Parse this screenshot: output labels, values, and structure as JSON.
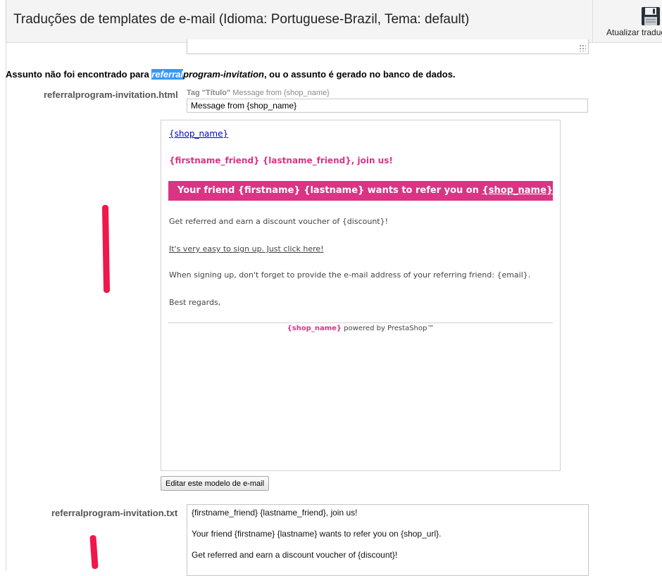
{
  "header": {
    "title": "Traduções de templates de e-mail (Idioma: Portuguese-Brazil, Tema: default)",
    "save_button_label": "Atualizar traduções",
    "save_icon": "floppy-disk-icon"
  },
  "subject_warning": {
    "prefix": "Assunto não foi encontrado para ",
    "highlight": "referral",
    "template_rest": "program-invitation",
    "suffix": ", ou o assunto é gerado no banco de dados."
  },
  "html_template": {
    "label": "referralprogram-invitation.html",
    "tag_label": "Tag \"Título\"",
    "tag_value": " Message from {shop_name}",
    "subject_value": "Message from {shop_name}",
    "edit_button": "Editar este modelo de e-mail",
    "preview": {
      "shop_link": "{shop_name}",
      "join_line": "{firstname_friend} {lastname_friend}, join us!",
      "banner_text": "Your friend {firstname} {lastname} wants to refer you on ",
      "banner_link": "{shop_name}",
      "banner_end": "!",
      "p1": "Get referred and earn a discount voucher of {discount}!",
      "p2": "It's very easy to sign up. Just click here!",
      "p3": "When signing up, don't forget to provide the e-mail address of your referring friend: {email}.",
      "p4": "Best regards,",
      "footer_shop": "{shop_name}",
      "footer_rest": " powered by PrestaShop™"
    },
    "accent_color": "#db3484"
  },
  "txt_template": {
    "label": "referralprogram-invitation.txt",
    "lines": [
      "{firstname_friend} {lastname_friend}, join us!",
      "Your friend {firstname} {lastname} wants to refer you on {shop_url}.",
      "Get referred and earn a discount voucher of {discount}!"
    ]
  },
  "annotation_color": "#f0174a"
}
